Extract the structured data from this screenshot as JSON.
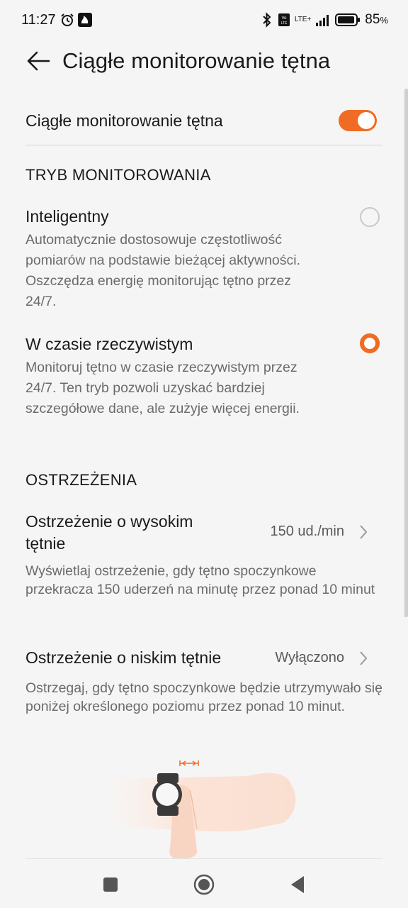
{
  "status": {
    "time": "11:27",
    "battery_level": "85",
    "battery_unit": "%",
    "network": "LTE+"
  },
  "header": {
    "title": "Ciągłe monitorowanie tętna"
  },
  "toggle_row": {
    "label": "Ciągłe monitorowanie tętna",
    "enabled": true
  },
  "monitoring_mode": {
    "header": "TRYB MONITOROWANIA",
    "options": [
      {
        "title": "Inteligentny",
        "description": "Automatycznie dostosowuje częstotliwość pomiarów na podstawie bieżącej aktywności. Oszczędza energię monitorując tętno przez 24/7.",
        "selected": false
      },
      {
        "title": "W czasie rzeczywistym",
        "description": "Monitoruj tętno w czasie rzeczywistym przez 24/7. Ten tryb pozwoli uzyskać bardziej szczegółowe dane, ale zużyje więcej energii.",
        "selected": true
      }
    ]
  },
  "warnings": {
    "header": "OSTRZEŻENIA",
    "items": [
      {
        "title": "Ostrzeżenie o wysokim tętnie",
        "value": "150 ud./min",
        "description": "Wyświetlaj ostrzeżenie, gdy tętno spoczynkowe przekracza 150 uderzeń na minutę przez ponad 10 minut"
      },
      {
        "title": "Ostrzeżenie o niskim tętnie",
        "value": "Wyłączono",
        "description": "Ostrzegaj, gdy tętno spoczynkowe będzie utrzymywało się poniżej określonego poziomu przez ponad 10 minut."
      }
    ]
  },
  "colors": {
    "accent": "#f06b24",
    "text_primary": "#1a1a1a",
    "text_secondary": "#6b6b6b",
    "background": "#f5f5f5"
  }
}
